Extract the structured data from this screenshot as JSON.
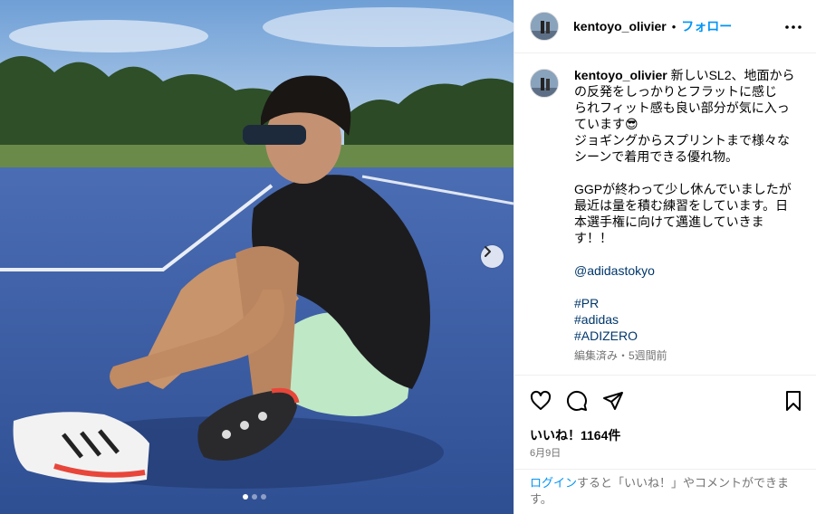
{
  "post": {
    "username": "kentoyo_olivier",
    "separator": "•",
    "follow_label": "フォロー",
    "caption": {
      "lines": [
        "新しいSL2、地面から",
        "の反発をしっかりとフラットに感じ",
        "られフィット感も良い部分が気に入っ",
        "ています😎",
        "ジョギングからスプリントまで様々な",
        "シーンで着用できる優れ物。"
      ],
      "paragraph2": [
        "GGPが終わって少し休んでいましたが",
        "最近は量を積む練習をしています。日",
        "本選手権に向けて邁進していきま",
        "す！！"
      ],
      "mention": "@adidastokyo",
      "hashtags": [
        "#PR",
        "#adidas",
        "#ADIZERO"
      ],
      "meta": "編集済み・5週間前"
    },
    "likes": "いいね！1164件",
    "date": "6月9日",
    "login_prompt": {
      "login": "ログイン",
      "rest": "すると「いいね！」やコメントができます。"
    }
  },
  "carousel": {
    "current": 1,
    "total": 3
  },
  "icons": {
    "more": "more-options-icon",
    "like": "heart-icon",
    "comment": "comment-icon",
    "share": "share-icon",
    "save": "bookmark-icon",
    "next": "chevron-right-icon"
  },
  "colors": {
    "accent": "#0095f6",
    "link": "#00376b",
    "muted": "#737373",
    "track": "#3a5ea8"
  }
}
